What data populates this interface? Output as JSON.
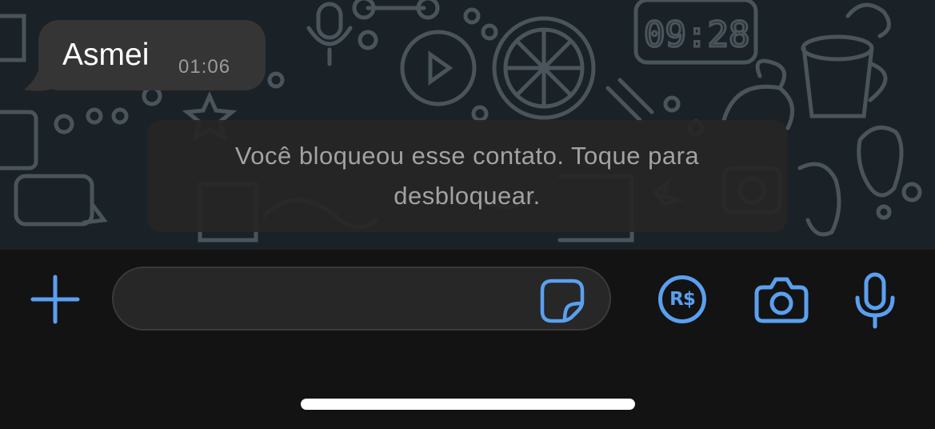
{
  "chat": {
    "message": {
      "text": "Asmei",
      "time": "01:06"
    },
    "notice": "Você bloqueou esse contato. Toque para desbloquear."
  },
  "input_bar": {
    "icons": [
      "plus-icon",
      "sticker-icon",
      "payment-icon",
      "camera-icon",
      "microphone-icon"
    ],
    "payment_icon_text": "R$",
    "accent_color": "#5aa0f0"
  },
  "wallpaper": {
    "clock_text": "09:28"
  },
  "colors": {
    "chat_background": "#1b2227",
    "bubble_background": "#353535",
    "input_bar_background": "#131313"
  }
}
